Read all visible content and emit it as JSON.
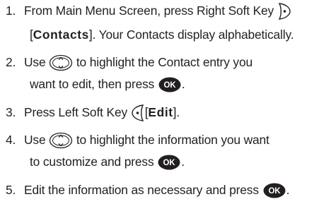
{
  "steps": [
    {
      "number": "1.",
      "line1_text": "From Main Menu Screen, press Right Soft Key",
      "line2_open": "[",
      "line2_bold": "Contacts",
      "line2_rest": "]. Your Contacts display alphabetically."
    },
    {
      "number": "2.",
      "line1_pre": "Use",
      "line1_post": "to highlight the Contact entry you",
      "line2_text": "want to edit, then press",
      "line2_end": "."
    },
    {
      "number": "3.",
      "line1_pre": "Press Left Soft Key",
      "line1_open": "[",
      "line1_bold": "Edit",
      "line1_close": "]."
    },
    {
      "number": "4.",
      "line1_pre": "Use",
      "line1_post": "to highlight the information you want",
      "line2_text": "to customize and press",
      "line2_end": "."
    },
    {
      "number": "5.",
      "line1_text": "Edit the information as necessary and press",
      "line1_end": "."
    }
  ],
  "icons": {
    "ok_label": "OK",
    "right_soft_key": "right-soft-key-icon",
    "left_soft_key": "left-soft-key-icon",
    "nav_key": "navigation-key-icon",
    "ok_key": "ok-key-icon"
  }
}
